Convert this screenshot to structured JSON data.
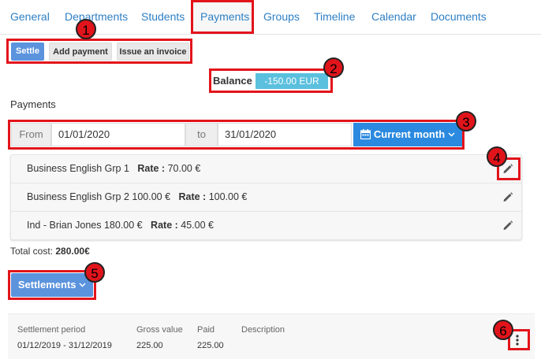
{
  "tabs": [
    "General",
    "Departments",
    "Students",
    "Payments",
    "Groups",
    "Timeline",
    "Calendar",
    "Documents"
  ],
  "actions": {
    "settle": "Settle",
    "add_payment": "Add payment",
    "issue_invoice": "Issue an invoice"
  },
  "balance": {
    "label": "Balance",
    "value": "-150.00 EUR"
  },
  "payments_heading": "Payments",
  "date_range": {
    "from_label": "From",
    "from_value": "01/01/2020",
    "to_label": "to",
    "to_value": "31/01/2020",
    "period_button": "Current month"
  },
  "groups": [
    {
      "name": "Business English Grp 1",
      "rate_label": "Rate :",
      "rate": "70.00 €"
    },
    {
      "name": "Business English Grp 2 100.00 €",
      "rate_label": "Rate :",
      "rate": "100.00 €"
    },
    {
      "name": "Ind - Brian Jones 180.00 €",
      "rate_label": "Rate :",
      "rate": "45.00 €"
    }
  ],
  "total": {
    "label": "Total cost:",
    "value": "280.00€"
  },
  "settlements": {
    "button": "Settlements",
    "headers": [
      "Settlement period",
      "Gross value",
      "Paid",
      "Description"
    ],
    "row": {
      "period": "01/12/2019 - 31/12/2019",
      "gross": "225.00",
      "paid": "225.00",
      "description": ""
    }
  },
  "callouts": [
    "1",
    "2",
    "3",
    "4",
    "5",
    "6"
  ],
  "colors": {
    "highlight": "#e2141b",
    "link": "#2e7fc4",
    "primary": "#2b8ae0",
    "info": "#5bc0de"
  }
}
